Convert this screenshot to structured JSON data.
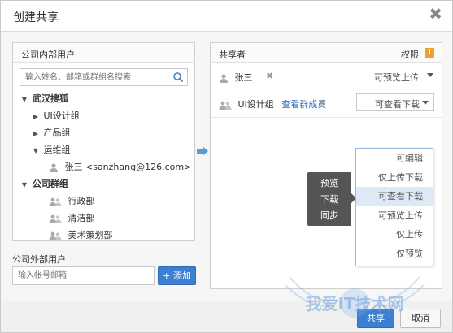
{
  "dialog": {
    "title": "创建共享",
    "close_glyph": "✖"
  },
  "left": {
    "header": "公司内部用户",
    "search_placeholder": "输入姓名、邮箱或群组名搜索",
    "tree": {
      "root1": "武汉搜狐",
      "child1": "UI设计组",
      "child2": "产品组",
      "child3": "运维组",
      "user1": "张三 <sanzhang@126.com>",
      "root2": "公司群组",
      "group1": "行政部",
      "group2": "清洁部",
      "group3": "美术策划部"
    },
    "external_label": "公司外部用户",
    "external_placeholder": "输入帐号邮箱",
    "add_button": "+ 添加"
  },
  "right": {
    "header": "共享者",
    "perm_header": "权限",
    "info_glyph": "i",
    "rows": [
      {
        "name": "张三",
        "permission": "可预览上传"
      },
      {
        "name": "UI设计组",
        "view_members": "查看群成员",
        "permission": "可查看下载"
      }
    ],
    "remove_glyph": "✖"
  },
  "tooltip": {
    "lines": [
      "预览",
      "下载",
      "同步"
    ]
  },
  "dropdown": {
    "options": [
      "可编辑",
      "仅上传下载",
      "可查看下载",
      "可预览上传",
      "仅上传",
      "仅预览"
    ],
    "selected": "可查看下载"
  },
  "footer": {
    "share_button": "共享",
    "cancel_button": "取消"
  },
  "watermark": {
    "text": "我爱IT技术网"
  },
  "colors": {
    "accent": "#3d7fd1",
    "link": "#2a6fc4",
    "tooltip_bg": "#555555",
    "info_badge": "#f0a030"
  }
}
